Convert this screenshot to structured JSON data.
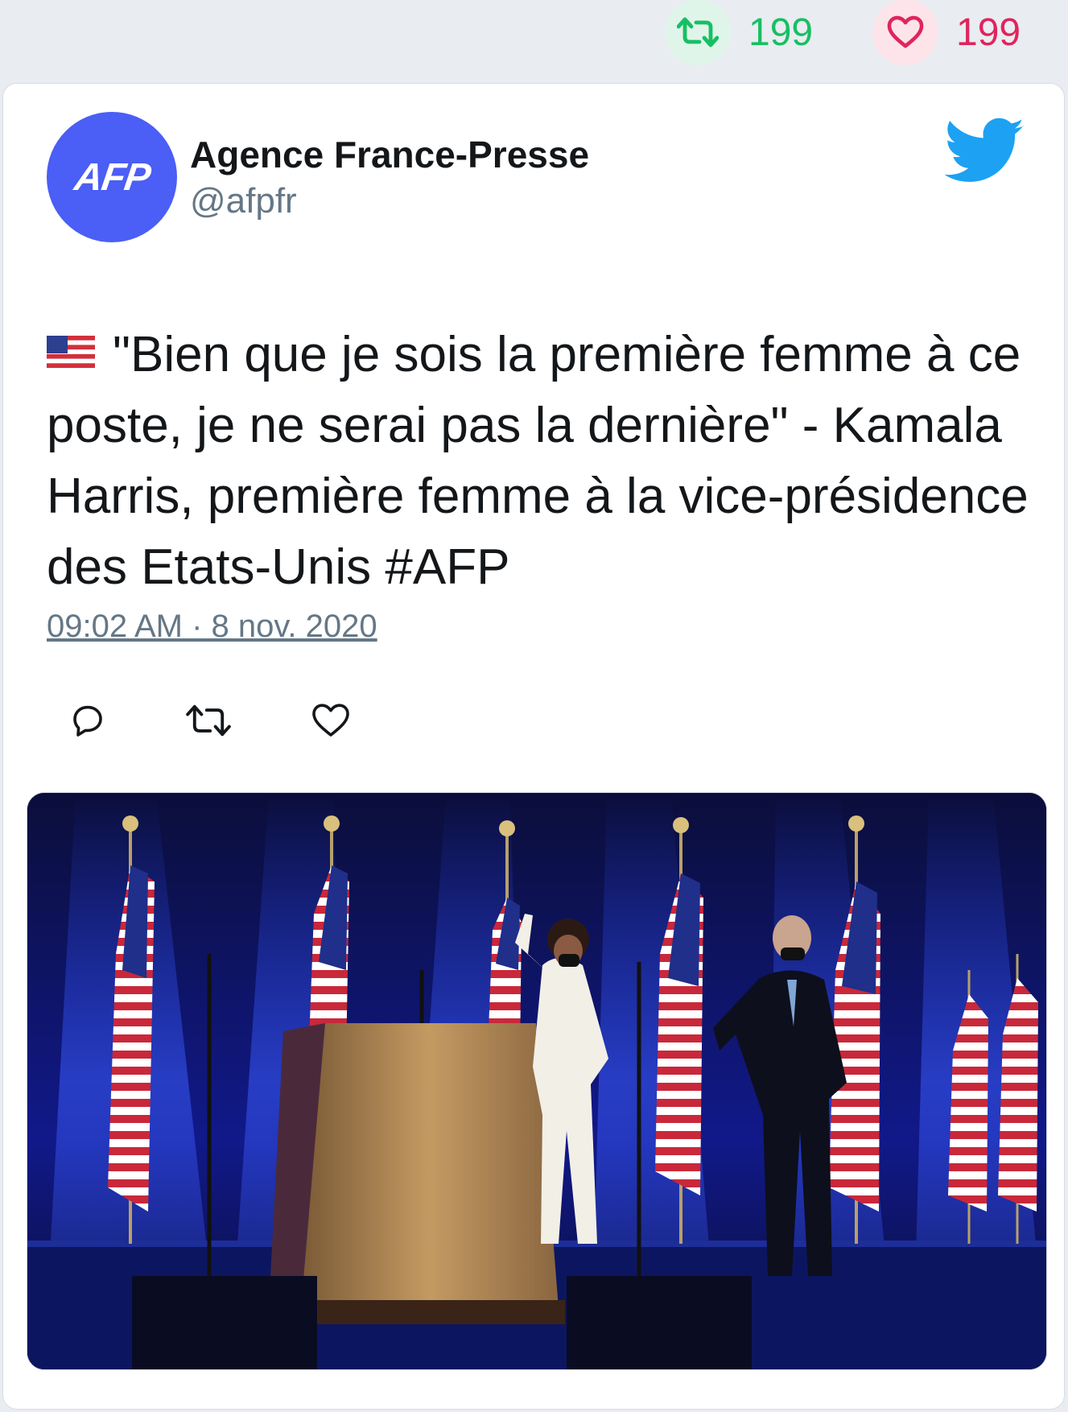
{
  "stats": {
    "retweet_count": "199",
    "like_count": "199"
  },
  "author": {
    "avatar_text": "AFP",
    "name": "Agence France-Presse",
    "handle": "@afpfr"
  },
  "tweet": {
    "flag": "us-flag-emoji",
    "text": "\"Bien que je sois la première femme à ce poste, je ne serai pas la dernière\" - Kamala Harris, première femme à la vice-présidence des Etats-Unis #AFP",
    "timestamp": "09:02 AM · 8 nov. 2020"
  },
  "icons": {
    "retweet": "retweet-icon",
    "like": "heart-icon",
    "reply": "reply-icon",
    "brand": "twitter-bird-icon"
  },
  "colors": {
    "retweet_green": "#17bf63",
    "like_red": "#e0245e",
    "twitter_blue": "#1da1f2",
    "avatar_blue": "#4b5ef5",
    "text_secondary": "#657786"
  }
}
